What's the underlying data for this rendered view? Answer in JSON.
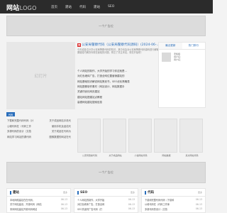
{
  "header": {
    "logo_main": "网站",
    "logo_sub": "LOGO",
    "nav": [
      "首页",
      "建站",
      "代码",
      "建站",
      "SEO"
    ]
  },
  "ads": {
    "top": "一个广告位",
    "bottom": "一个广告位"
  },
  "slide": {
    "label": "幻灯片"
  },
  "headline": {
    "title": "公安局警察代码（公安局警察代码源码）(2024-06-..",
    "desc": "今天给各位分享公安局警察代码的知识，其中也会对公安局警察代码源码进行解释，如果能碰巧解决你现在面临的问题，别忘了关注本站，现在开始吧！"
  },
  "news": [
    {
      "title": "个人网站的制作，大学开始的学习你这就是…",
      "date": "06-13"
    },
    {
      "title": "对红色墙体广告，打造全网位置营销建站的",
      "date": "06-13"
    },
    {
      "title": "网站基础知识解说网站策划书，SEO优化策略表",
      "date": "06-13"
    },
    {
      "title": "网站图像制作素材（网站设计、网站数据手",
      "date": "06-13"
    },
    {
      "title": "关键词优化网页建站",
      "date": "06-13"
    },
    {
      "title": "建站网站搭建站点教程",
      "date": "06-13"
    },
    {
      "title": "高德网站建站搜索信息",
      "date": "06-13"
    }
  ],
  "sidebar": {
    "tabs": [
      "最近更新",
      "热门排行"
    ],
    "user": {
      "name": "老板娘",
      "line2": "用户名：",
      "line3": "用户名："
    }
  },
  "section_tag": "代码",
  "small_list": [
    {
      "title": "下载和完整代码代码（计",
      "date": ""
    },
    {
      "title": "公墙代码在（代码工作",
      "date": ""
    },
    {
      "title": "多源代码的设计（文档",
      "date": ""
    },
    {
      "title": "网站学习网站的源代码",
      "date": ""
    }
  ],
  "gallery_right_text": [
    "关于成品网站手机代",
    "使用手机及品站代",
    "关于成品在代码为",
    "图像数据的网站在代"
  ],
  "gallery": [
    {
      "caption": "公安局警察代码"
    },
    {
      "caption": "关于成品网站"
    },
    {
      "caption": "小说网站代码"
    },
    {
      "caption": "网站数据"
    },
    {
      "caption": "来文网站代码"
    }
  ],
  "columns": [
    {
      "name": "建站",
      "more": "更多",
      "items": [
        {
          "title": "本地网络建站在在代码，",
          "date": "06-13"
        },
        {
          "title": "关于网站建设，开源代码（网站",
          "date": "06-13"
        },
        {
          "title": "宋体网站建站开源代码网站",
          "date": "06-13"
        },
        {
          "title": "来设网站建设开源代码和网站",
          "date": "06-13"
        }
      ]
    },
    {
      "name": "SEO",
      "more": "更多",
      "items": [
        {
          "title": "个人网站的制作，大学开始",
          "date": "06-13"
        },
        {
          "title": "对红色墙体广告，打造全网",
          "date": "06-13"
        },
        {
          "title": "SEO关键词广告代码（打",
          "date": "06-13"
        },
        {
          "title": "网络推广引擎文字代码",
          "date": "06-13"
        }
      ]
    },
    {
      "name": "代码",
      "more": "更多",
      "items": [
        {
          "title": "下载和完整代码代码（下载和",
          "date": "06-13"
        },
        {
          "title": "公墙代码在（代码工作库",
          "date": "06-13"
        },
        {
          "title": "多源代码的设计（文档",
          "date": "06-13"
        },
        {
          "title": "网站学习网站的源代码",
          "date": "06-13"
        }
      ]
    }
  ]
}
